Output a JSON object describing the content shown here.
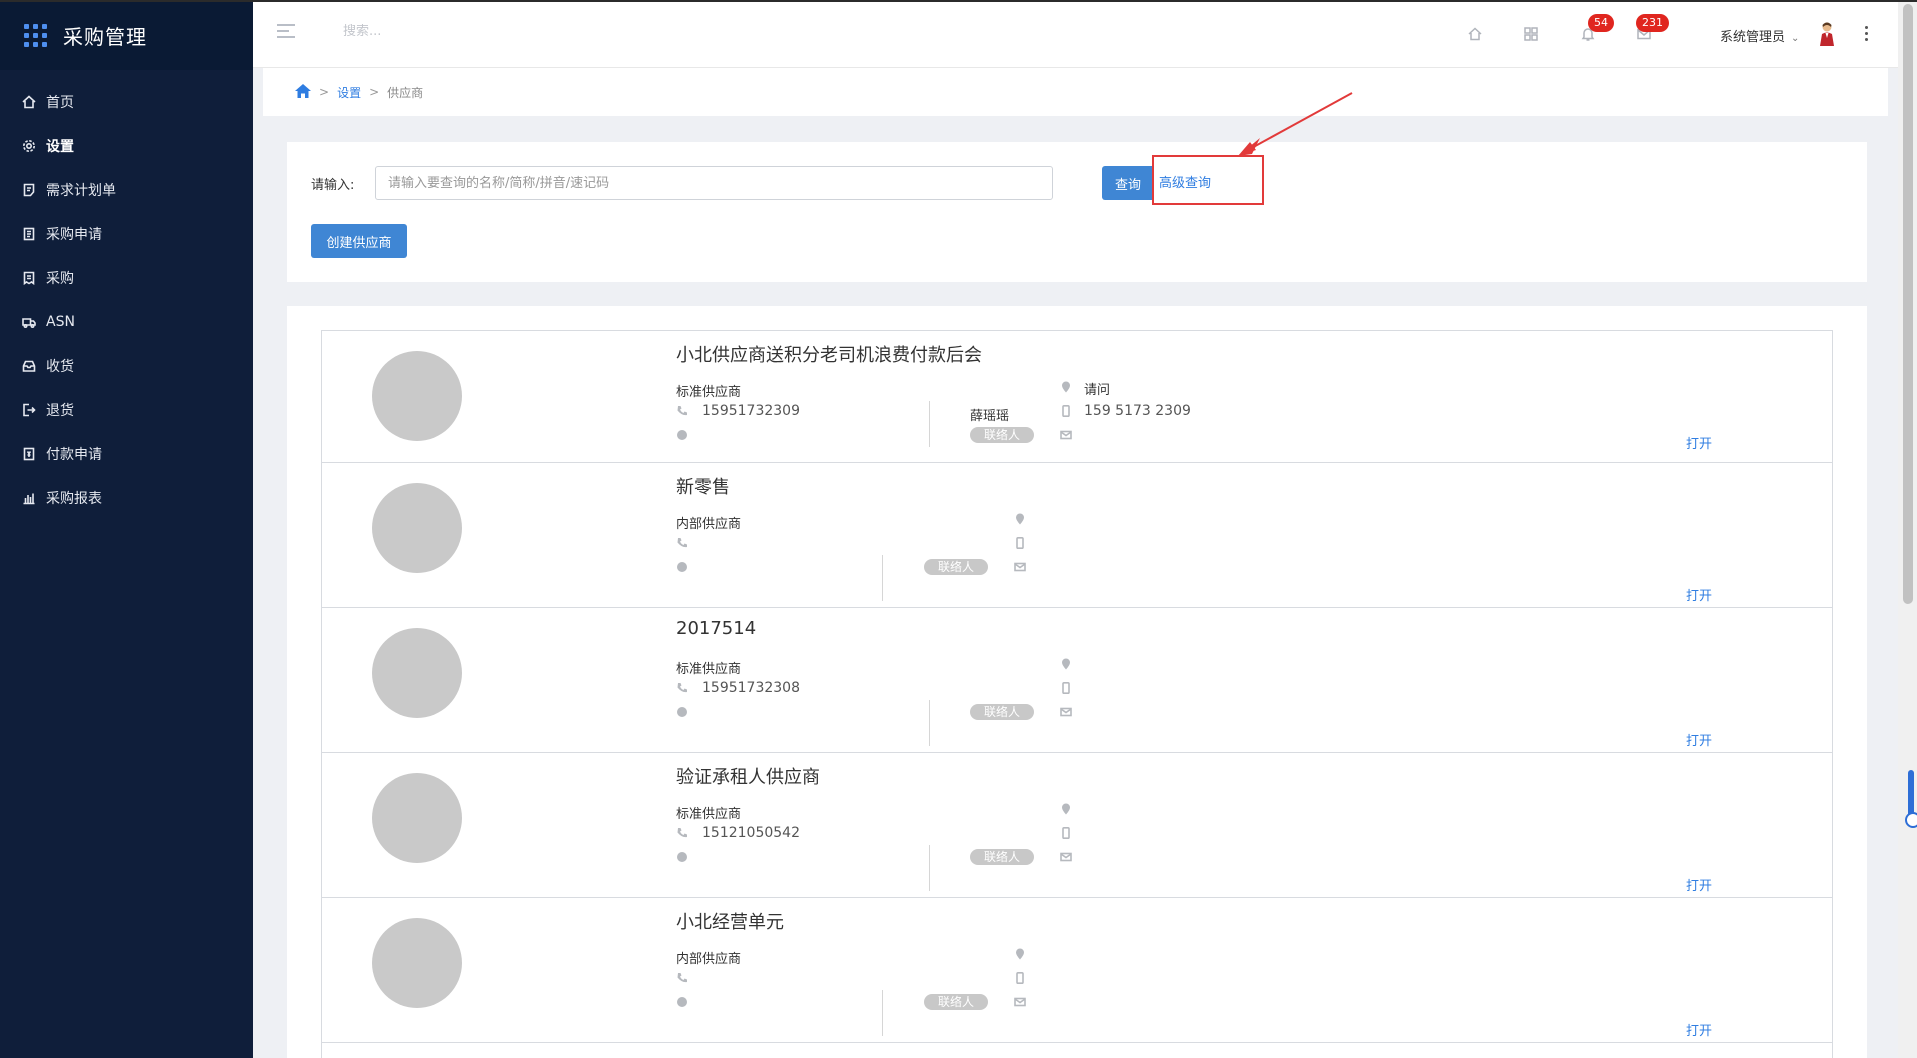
{
  "app": {
    "title": "采购管理"
  },
  "sidebar": {
    "items": [
      {
        "label": "首页",
        "icon": "home-icon"
      },
      {
        "label": "设置",
        "icon": "gear-icon",
        "active": true
      },
      {
        "label": "需求计划单",
        "icon": "document-icon"
      },
      {
        "label": "采购申请",
        "icon": "clipboard-icon"
      },
      {
        "label": "采购",
        "icon": "receipt-icon"
      },
      {
        "label": "ASN",
        "icon": "truck-icon"
      },
      {
        "label": "收货",
        "icon": "inbox-icon"
      },
      {
        "label": "退货",
        "icon": "return-icon"
      },
      {
        "label": "付款申请",
        "icon": "payment-icon"
      },
      {
        "label": "采购报表",
        "icon": "bar-chart-icon"
      }
    ]
  },
  "header": {
    "search_placeholder": "搜索...",
    "notifications_count": "54",
    "messages_count": "231",
    "user_name": "系统管理员"
  },
  "breadcrumb": {
    "level1": "设置",
    "level2": "供应商"
  },
  "query": {
    "label": "请输入:",
    "input_placeholder": "请输入要查询的名称/简称/拼音/速记码",
    "search_button": "查询",
    "advanced_link": "高级查询",
    "create_button": "创建供应商"
  },
  "suppliers": [
    {
      "name": "小北供应商送积分老司机浪费付款后会",
      "type": "标准供应商",
      "phone": "15951732309",
      "contact_name": "薛瑶瑶",
      "contact_pill": "联络人",
      "address": "请问",
      "mobile": "159 5173 2309",
      "open": "打开"
    },
    {
      "name": "新零售",
      "type": "内部供应商",
      "phone": "",
      "contact_name": "",
      "contact_pill": "联络人",
      "address": "",
      "mobile": "",
      "open": "打开"
    },
    {
      "name": "2017514",
      "type": "标准供应商",
      "phone": "15951732308",
      "contact_name": "",
      "contact_pill": "联络人",
      "address": "",
      "mobile": "",
      "open": "打开"
    },
    {
      "name": "验证承租人供应商",
      "type": "标准供应商",
      "phone": "15121050542",
      "contact_name": "",
      "contact_pill": "联络人",
      "address": "",
      "mobile": "",
      "open": "打开"
    },
    {
      "name": "小北经营单元",
      "type": "内部供应商",
      "phone": "",
      "contact_name": "",
      "contact_pill": "联络人",
      "address": "",
      "mobile": "",
      "open": "打开"
    }
  ],
  "colors": {
    "sidebar_bg": "#0f1e3a",
    "accent": "#3f86d4",
    "link": "#2f7de1",
    "badge": "#e0261f",
    "annotation": "#e23a3a"
  }
}
